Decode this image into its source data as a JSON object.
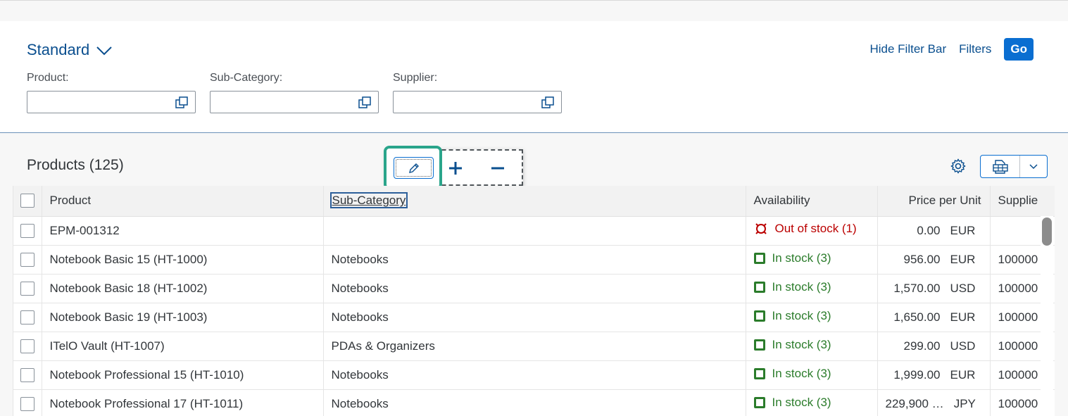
{
  "filter_bar": {
    "variant": "Standard",
    "hide_label": "Hide Filter Bar",
    "filters_label": "Filters",
    "go_label": "Go",
    "fields": [
      {
        "label": "Product:",
        "value": ""
      },
      {
        "label": "Sub-Category:",
        "value": ""
      },
      {
        "label": "Supplier:",
        "value": ""
      }
    ]
  },
  "table_toolbar": {
    "title": "Products (125)",
    "icons": {
      "edit": "pencil-icon",
      "add": "plus-icon",
      "remove": "minus-icon",
      "settings": "gear-icon",
      "export": "spreadsheet-export-icon"
    }
  },
  "table": {
    "columns": [
      "Product",
      "Sub-Category",
      "Availability",
      "Price per Unit",
      "Supplie"
    ],
    "rows": [
      {
        "product": "EPM-001312",
        "subcategory": "",
        "availability": "Out of stock (1)",
        "status": "error",
        "price": "0.00",
        "currency": "EUR",
        "supplier": ""
      },
      {
        "product": "Notebook Basic 15 (HT-1000)",
        "subcategory": "Notebooks",
        "availability": "In stock (3)",
        "status": "success",
        "price": "956.00",
        "currency": "EUR",
        "supplier": "100000"
      },
      {
        "product": "Notebook Basic 18 (HT-1002)",
        "subcategory": "Notebooks",
        "availability": "In stock (3)",
        "status": "success",
        "price": "1,570.00",
        "currency": "USD",
        "supplier": "100000"
      },
      {
        "product": "Notebook Basic 19 (HT-1003)",
        "subcategory": "Notebooks",
        "availability": "In stock (3)",
        "status": "success",
        "price": "1,650.00",
        "currency": "EUR",
        "supplier": "100000"
      },
      {
        "product": "ITelO Vault (HT-1007)",
        "subcategory": "PDAs & Organizers",
        "availability": "In stock (3)",
        "status": "success",
        "price": "299.00",
        "currency": "USD",
        "supplier": "100000"
      },
      {
        "product": "Notebook Professional 15 (HT-1010)",
        "subcategory": "Notebooks",
        "availability": "In stock (3)",
        "status": "success",
        "price": "1,999.00",
        "currency": "EUR",
        "supplier": "100000"
      },
      {
        "product": "Notebook Professional 17 (HT-1011)",
        "subcategory": "Notebooks",
        "availability": "In stock (3)",
        "status": "success",
        "price": "229,900 …",
        "currency": "JPY",
        "supplier": "100000"
      }
    ]
  },
  "colors": {
    "accent": "#0a6ed1",
    "success": "#2b7c2b",
    "error": "#bb0000",
    "selection": "#2aa58b"
  }
}
